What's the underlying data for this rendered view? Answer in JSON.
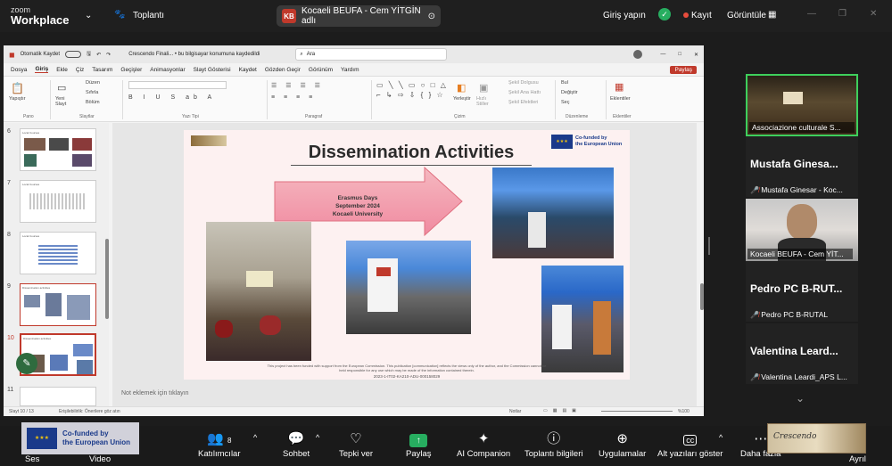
{
  "topbar": {
    "zoom_line1": "zoom",
    "zoom_line2": "Workplace",
    "meeting_label": "Toplantı",
    "share_initials": "KB",
    "share_text": "Kocaeli BEUFA - Cem YİTGİN adlı",
    "sign_in": "Giriş yapın",
    "record": "Kayıt",
    "view": "Görüntüle"
  },
  "ppt": {
    "title_file": "Crescendo Finali... • bu bilgisayar konumuna kaydedildi",
    "autosave": "Otomatik Kaydet",
    "search": "Ara",
    "share_btn": "Paylaş",
    "menu": [
      "Dosya",
      "Giriş",
      "Ekle",
      "Çiz",
      "Tasarım",
      "Geçişler",
      "Animasyonlar",
      "Slayt Gösterisi",
      "Kaydet",
      "Gözden Geçir",
      "Görünüm",
      "Yardım"
    ],
    "groups": [
      "Pano",
      "Slaytlar",
      "Yazı Tipi",
      "Paragraf",
      "Çizim",
      "Düzenleme",
      "Eklentiler"
    ],
    "ribbon": {
      "paste": "Yapıştır",
      "new_slide": "Yeni Slayt",
      "layout": "Düzen",
      "reset": "Sıfırla",
      "section": "Bölüm",
      "arrange": "Yerleştir",
      "quick_styles": "Hızlı Stiller",
      "shape_fill": "Şekil Dolgusu",
      "shape_outline": "Şekil Ana Hattı",
      "shape_effects": "Şekil Efektleri",
      "find": "Bul",
      "replace": "Değiştir",
      "select": "Seç",
      "addins": "Eklentiler"
    },
    "thumb_numbers": [
      "6",
      "7",
      "8",
      "9",
      "10",
      "11"
    ],
    "thumb_titles": [
      "Local Courses",
      "Local Courses",
      "Local Courses",
      "Dissemination activities",
      "Dissemination activities",
      ""
    ],
    "slide": {
      "title": "Dissemination Activities",
      "eu_line1": "Co-funded by",
      "eu_line2": "the European Union",
      "arrow_line1": "Erasmus Days",
      "arrow_line2": "September 2024",
      "arrow_line3": "Kocaeli University",
      "disclaimer": "This project has been funded with support from the European Commission. This publication [communication] reflects the views only of the author, and the Commission cannot be held responsible for any use which may be made of the information contained therein.",
      "project_code": "2023-1-IT02-KA210-ADU-000158029"
    },
    "notes": "Not eklemek için tıklayın",
    "status_left": "Slayt 10 / 13",
    "accessibility": "Erişilebilirlik: Önerilere göz atın",
    "notes_btn": "Notlar",
    "zoom_pct": "%100"
  },
  "participants": [
    {
      "name": "Associazione culturale S...",
      "sub": ""
    },
    {
      "name": "Mustafa  Ginesa...",
      "sub": "Mustafa Ginesar - Koc..."
    },
    {
      "name": "",
      "sub": "Kocaeli BEUFA - Cem YİT..."
    },
    {
      "name": "Pedro PC B-RUT...",
      "sub": "Pedro PC B-RUTAL"
    },
    {
      "name": "Valentina  Leard...",
      "sub": "Valentina Leardi_APS L..."
    }
  ],
  "toolbar": {
    "audio": "Ses",
    "video": "Video",
    "participants": "Katılımcılar",
    "participant_count": "8",
    "chat": "Sohbet",
    "react": "Tepki ver",
    "share": "Paylaş",
    "ai": "AI Companion",
    "info": "Toplantı bilgileri",
    "apps": "Uygulamalar",
    "captions": "Alt yazıları göster",
    "more": "Daha fazla",
    "leave": "Ayrıl",
    "overlay_eu1": "Co-funded by",
    "overlay_eu2": "the European Union",
    "crescendo": "Crescendo"
  },
  "colors": {
    "accent_red": "#c0392b",
    "share_green": "#27ae60",
    "record_red": "#e74c3c",
    "slide_bg": "#fdf1f1",
    "eu_blue": "#1a3a8a"
  }
}
